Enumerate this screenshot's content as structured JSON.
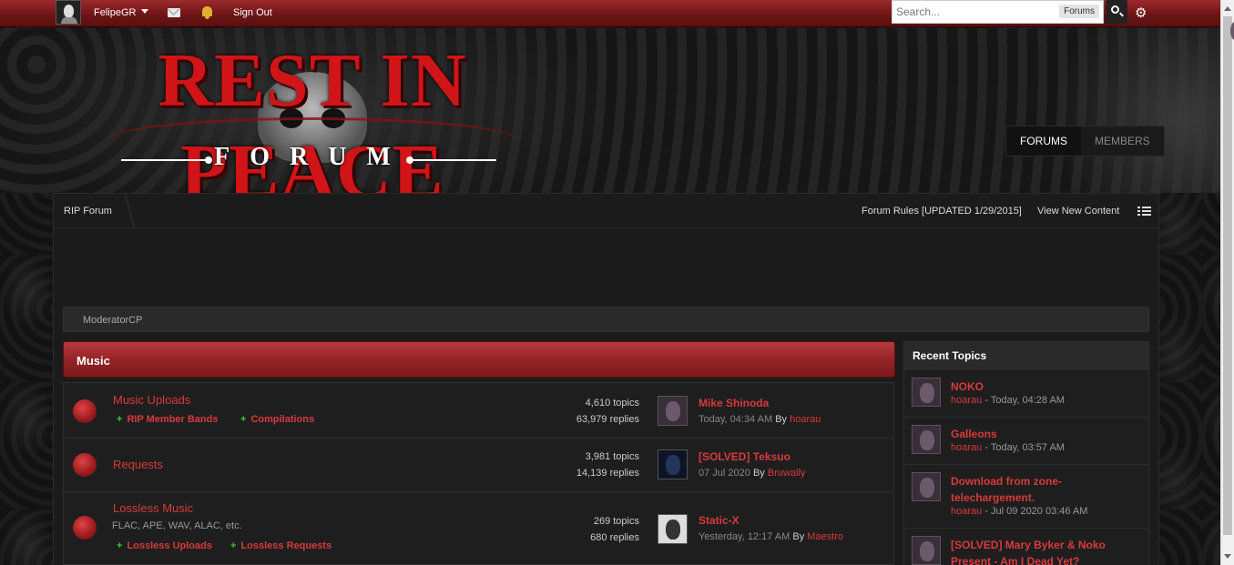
{
  "topbar": {
    "username": "FelipeGR",
    "sign_out": "Sign Out",
    "search_placeholder": "Search...",
    "search_scope": "Forums"
  },
  "header": {
    "logo_title": "REST IN PEACE",
    "logo_subtitle": "FORUM",
    "tabs": [
      {
        "label": "FORUMS",
        "active": true
      },
      {
        "label": "MEMBERS",
        "active": false
      }
    ]
  },
  "breadcrumb": {
    "home": "RIP Forum",
    "rules_link": "Forum Rules [UPDATED 1/29/2015]",
    "new_content": "View New Content"
  },
  "modbar": {
    "label": "ModeratorCP"
  },
  "category": {
    "title": "Music"
  },
  "forums": [
    {
      "name": "Music Uploads",
      "description": "",
      "subforums": [
        "RIP Member Bands",
        "Compilations"
      ],
      "topics": "4,610 topics",
      "replies": "63,979 replies",
      "last_title": "Mike Shinoda",
      "last_date": "Today, 04:34 AM",
      "last_by": "hoarau"
    },
    {
      "name": "Requests",
      "description": "",
      "subforums": [],
      "topics": "3,981 topics",
      "replies": "14,139 replies",
      "last_title": "[SOLVED] Teksuo",
      "last_date": "07 Jul 2020",
      "last_by": "Bruwally"
    },
    {
      "name": "Lossless Music",
      "description": "FLAC, APE, WAV, ALAC, etc.",
      "subforums": [
        "Lossless Uploads",
        "Lossless Requests"
      ],
      "topics": "269 topics",
      "replies": "680 replies",
      "last_title": "Static-X",
      "last_date": "Yesterday, 12:17 AM",
      "last_by": "Maestro"
    }
  ],
  "recent": {
    "heading": "Recent Topics",
    "items": [
      {
        "title": "NOKO",
        "by": "hoarau",
        "date": " - Today, 04:28 AM"
      },
      {
        "title": "Galleons",
        "by": "hoarau",
        "date": " - Today, 03:57 AM"
      },
      {
        "title": "Download from zone-telechargement.",
        "by": "hoarau",
        "date": " - Jul 09 2020 03:46 AM"
      },
      {
        "title": "[SOLVED] Mary Byker & Noko Present - Am I Dead Yet?",
        "by": "",
        "date": ""
      }
    ]
  },
  "by_word": "By"
}
